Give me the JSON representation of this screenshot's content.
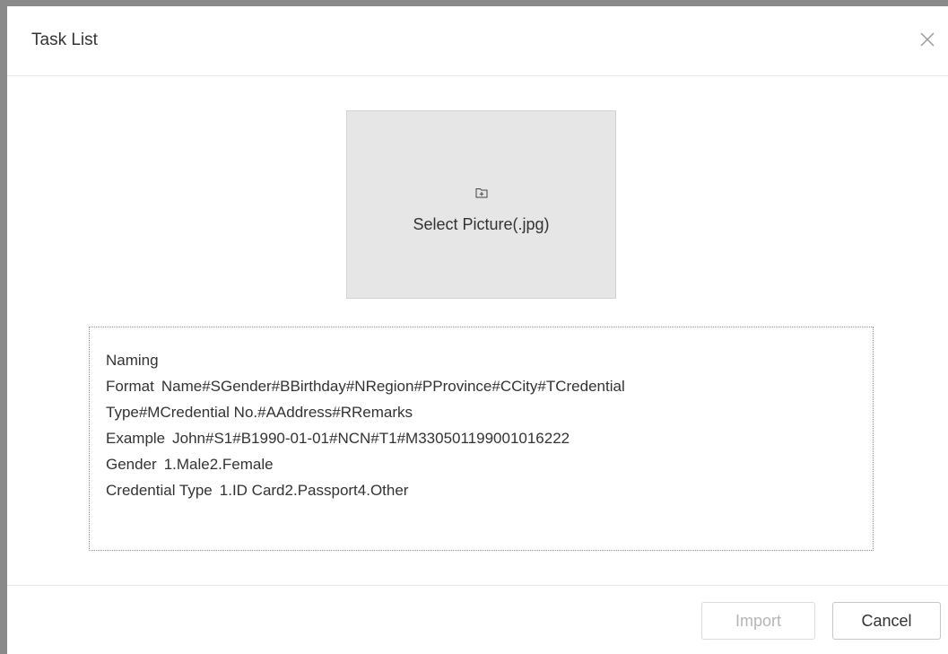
{
  "dialog": {
    "title": "Task List",
    "close_icon": "close-icon"
  },
  "upload": {
    "icon": "folder-plus-icon",
    "label": "Select Picture(.jpg)"
  },
  "naming": {
    "heading": "Naming",
    "format_key": "Format",
    "format_value": "Name#SGender#BBirthday#NRegion#PProvince#CCity#TCredential",
    "format_continuation": "Type#MCredential No.#AAddress#RRemarks",
    "example_key": "Example",
    "example_value": "John#S1#B1990-01-01#NCN#T1#M330501199001016222",
    "gender_key": "Gender",
    "gender_value": "1.Male2.Female",
    "credential_key": "Credential Type",
    "credential_value": "1.ID Card2.Passport4.Other"
  },
  "footer": {
    "import_label": "Import",
    "import_disabled": true,
    "cancel_label": "Cancel"
  }
}
